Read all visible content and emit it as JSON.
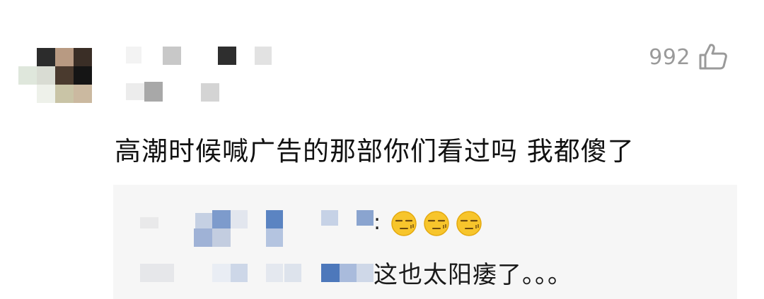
{
  "comment": {
    "like_count": "992",
    "like_icon": "thumbs-up-outline-icon",
    "text": "高潮时候喊广告的那部你们看过吗 我都傻了"
  },
  "reply": {
    "colon": ":",
    "emoji_names": [
      "awkward-face-emoji",
      "awkward-face-emoji",
      "awkward-face-emoji"
    ],
    "text": "这也太阳痿了。。。"
  },
  "colors": {
    "like_gray": "#9a9a9a",
    "reply_bg": "#f6f6f6",
    "emoji_yellow": "#f7c52c"
  }
}
